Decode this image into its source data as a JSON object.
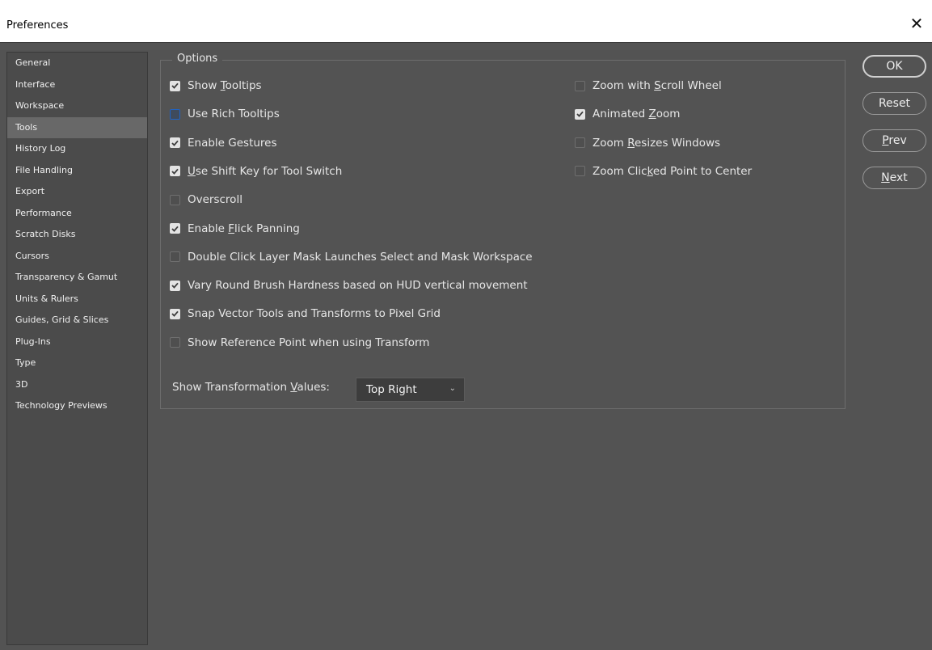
{
  "window": {
    "title": "Preferences",
    "close_glyph": "✕"
  },
  "sidebar": {
    "items": [
      {
        "label": "General"
      },
      {
        "label": "Interface"
      },
      {
        "label": "Workspace"
      },
      {
        "label": "Tools",
        "selected": true
      },
      {
        "label": "History Log"
      },
      {
        "label": "File Handling"
      },
      {
        "label": "Export"
      },
      {
        "label": "Performance"
      },
      {
        "label": "Scratch Disks"
      },
      {
        "label": "Cursors"
      },
      {
        "label": "Transparency & Gamut"
      },
      {
        "label": "Units & Rulers"
      },
      {
        "label": "Guides, Grid & Slices"
      },
      {
        "label": "Plug-Ins"
      },
      {
        "label": "Type"
      },
      {
        "label": "3D"
      },
      {
        "label": "Technology Previews"
      }
    ]
  },
  "options": {
    "legend": "Options",
    "left": [
      {
        "pre": "Show ",
        "u": "T",
        "post": "ooltips",
        "checked": true
      },
      {
        "pre": "Use Rich Tooltips",
        "u": "",
        "post": "",
        "checked": false,
        "focused": true
      },
      {
        "pre": "Enable Gestures",
        "u": "",
        "post": "",
        "checked": true
      },
      {
        "pre": "",
        "u": "U",
        "post": "se Shift Key for Tool Switch",
        "checked": true
      },
      {
        "pre": "Overscroll",
        "u": "",
        "post": "",
        "checked": false
      },
      {
        "pre": "Enable ",
        "u": "F",
        "post": "lick Panning",
        "checked": true
      },
      {
        "pre": "Double Click Layer Mask Launches Select and Mask Workspace",
        "u": "",
        "post": "",
        "checked": false
      },
      {
        "pre": "Vary Round Brush Hardness based on HUD vertical movement",
        "u": "",
        "post": "",
        "checked": true
      },
      {
        "pre": "Snap Vector Tools and Transforms to Pixel Grid",
        "u": "",
        "post": "",
        "checked": true
      },
      {
        "pre": "Show Reference Point when using Transform",
        "u": "",
        "post": "",
        "checked": false
      }
    ],
    "right": [
      {
        "pre": "Zoom with ",
        "u": "S",
        "post": "croll Wheel",
        "checked": false
      },
      {
        "pre": "Animated ",
        "u": "Z",
        "post": "oom",
        "checked": true
      },
      {
        "pre": "Zoom ",
        "u": "R",
        "post": "esizes Windows",
        "checked": false
      },
      {
        "pre": "Zoom Clic",
        "u": "k",
        "post": "ed Point to Center",
        "checked": false
      }
    ],
    "transform": {
      "label_pre": "Show Transformation ",
      "label_u": "V",
      "label_post": "alues:",
      "value": "Top Right",
      "chevron": "⌄"
    }
  },
  "buttons": [
    {
      "pre": "OK",
      "u": "",
      "post": "",
      "default": true
    },
    {
      "pre": "Reset",
      "u": "",
      "post": ""
    },
    {
      "pre": "",
      "u": "P",
      "post": "rev"
    },
    {
      "pre": "",
      "u": "N",
      "post": "ext"
    }
  ],
  "icons": {
    "close": "close-icon",
    "check": "checkmark-icon",
    "dropdown": "chevron-down-icon"
  },
  "colors": {
    "background": "#535353",
    "sidebar_selected": "#686868",
    "focus_ring": "#1f63c4"
  }
}
